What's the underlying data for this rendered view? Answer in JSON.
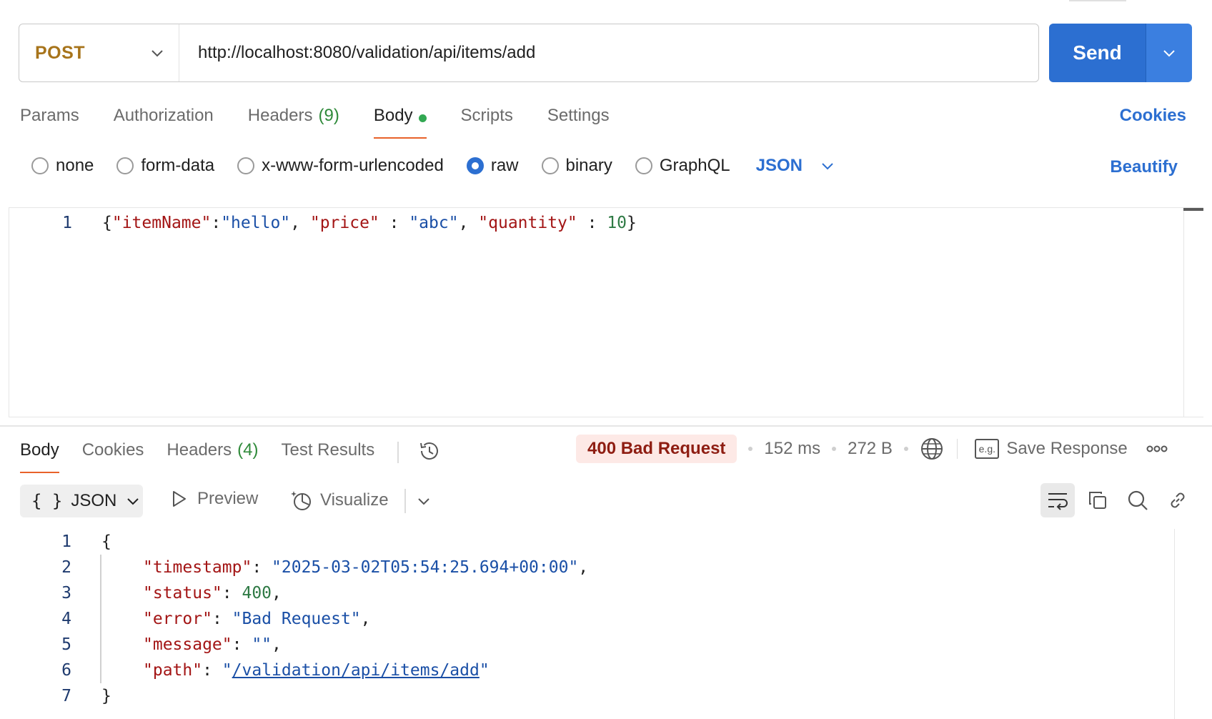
{
  "request": {
    "method": "POST",
    "url": "http://localhost:8080/validation/api/items/add",
    "send_label": "Send"
  },
  "request_tabs": {
    "params": "Params",
    "authorization": "Authorization",
    "headers": "Headers",
    "headers_count": "(9)",
    "body": "Body",
    "scripts": "Scripts",
    "settings": "Settings",
    "cookies": "Cookies"
  },
  "body_types": {
    "none": "none",
    "form_data": "form-data",
    "urlencoded": "x-www-form-urlencoded",
    "raw": "raw",
    "binary": "binary",
    "graphql": "GraphQL",
    "selected": "raw",
    "language": "JSON",
    "beautify": "Beautify"
  },
  "request_body": {
    "line_number": "1",
    "tokens": {
      "open": "{",
      "k1": "\"itemName\"",
      "sep1": ":",
      "v1": "\"hello\"",
      "c1": ", ",
      "k2": "\"price\"",
      "sep2": " : ",
      "v2": "\"abc\"",
      "c2": ", ",
      "k3": "\"quantity\"",
      "sep3": " : ",
      "v3": "10",
      "close": "}"
    }
  },
  "response_tabs": {
    "body": "Body",
    "cookies": "Cookies",
    "headers": "Headers",
    "headers_count": "(4)",
    "test_results": "Test Results"
  },
  "response_meta": {
    "status": "400 Bad Request",
    "time": "152 ms",
    "size": "272 B",
    "save_icon_text": "e.g.",
    "save_response": "Save Response"
  },
  "response_toolbar": {
    "format_braces": "{ }",
    "format": "JSON",
    "preview": "Preview",
    "visualize": "Visualize"
  },
  "response_body": {
    "line_numbers": [
      "1",
      "2",
      "3",
      "4",
      "5",
      "6",
      "7"
    ],
    "open": "{",
    "timestamp_key": "\"timestamp\"",
    "timestamp_val": "\"2025-03-02T05:54:25.694+00:00\"",
    "status_key": "\"status\"",
    "status_val": "400",
    "error_key": "\"error\"",
    "error_val": "\"Bad Request\"",
    "message_key": "\"message\"",
    "message_val": "\"\"",
    "path_key": "\"path\"",
    "path_quote": "\"",
    "path_val": "/validation/api/items/add",
    "close": "}",
    "colon": ": ",
    "comma": ","
  },
  "colors": {
    "accent": "#2c6fd1",
    "method": "#a7741b",
    "tab_underline": "#e8622a",
    "success_dot": "#32a852",
    "status_bg": "#fde9e6",
    "status_text": "#8e1d12"
  }
}
